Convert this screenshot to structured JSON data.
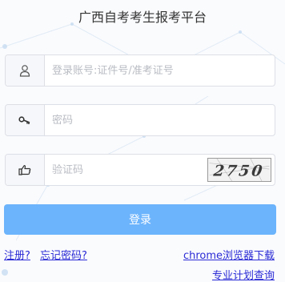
{
  "header": {
    "title": "广西自考考生报考平台"
  },
  "form": {
    "username": {
      "placeholder": "登录账号:证件号/准考证号",
      "value": "",
      "icon": "user-icon"
    },
    "password": {
      "placeholder": "密码",
      "value": "",
      "icon": "key-icon"
    },
    "captcha": {
      "placeholder": "验证码",
      "value": "",
      "icon": "pointing-hand-icon",
      "image_text": "2750"
    }
  },
  "actions": {
    "login_label": "登录"
  },
  "links": {
    "register": "注册?",
    "forgot_password": "忘记密码?",
    "chrome_download": "chrome浏览器下载",
    "major_plan_query": "专业计划查询"
  },
  "colors": {
    "accent": "#6cb4fc",
    "link": "#2b2bd6",
    "border": "#dcdfe6",
    "icon_bg": "#f5f7fa"
  }
}
